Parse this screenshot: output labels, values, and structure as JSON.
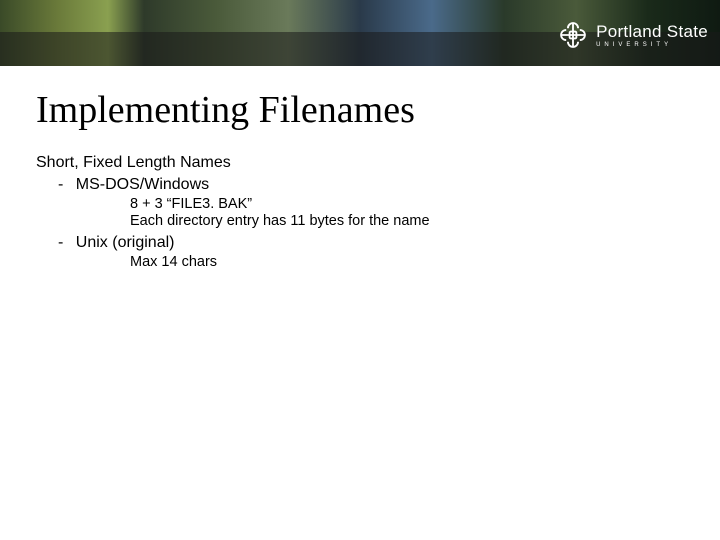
{
  "brand": {
    "name": "Portland State",
    "sub": "UNIVERSITY"
  },
  "slide": {
    "title": "Implementing Filenames",
    "subhead": "Short, Fixed Length Names",
    "bullets": [
      {
        "label": "MS-DOS/Windows",
        "sub": [
          "8 + 3  “FILE3. BAK”",
          "Each directory entry has 11 bytes for the name"
        ]
      },
      {
        "label": "Unix (original)",
        "sub": [
          "Max 14 chars"
        ]
      }
    ]
  }
}
